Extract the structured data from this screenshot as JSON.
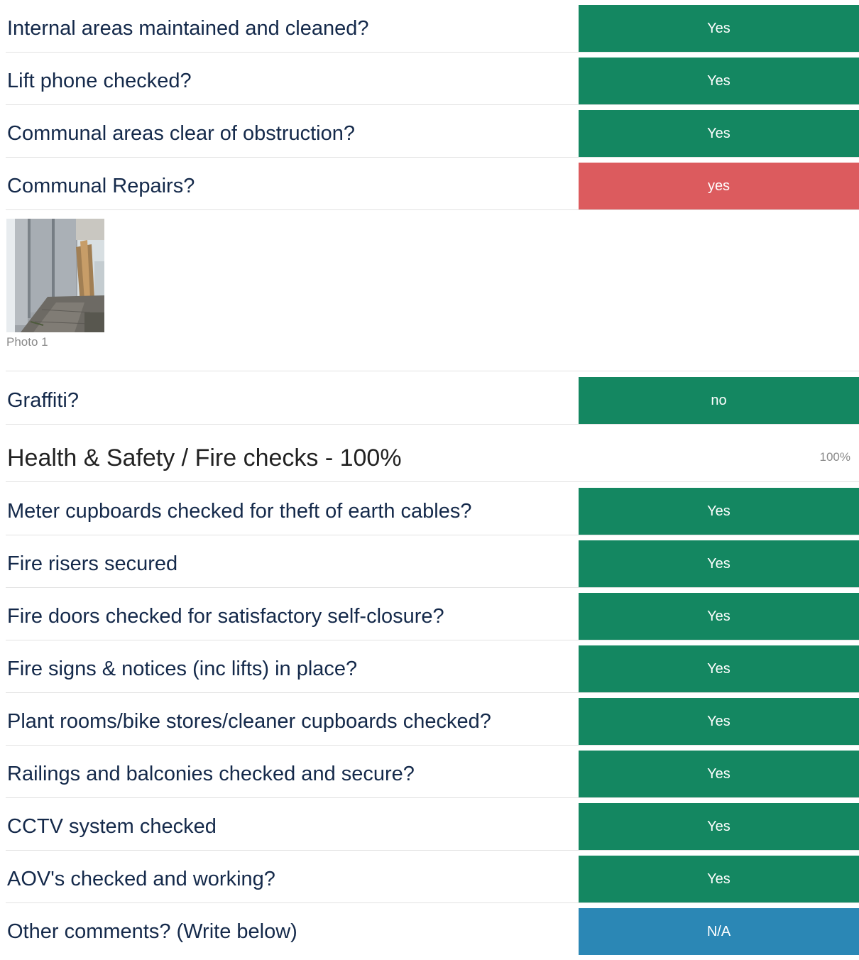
{
  "colors": {
    "green": "#148761",
    "red": "#dc5b5e",
    "blue": "#2b87b5"
  },
  "rows_before_photo": [
    {
      "question": "Internal areas maintained and cleaned?",
      "answer": "Yes",
      "status": "green"
    },
    {
      "question": "Lift phone checked?",
      "answer": "Yes",
      "status": "green"
    },
    {
      "question": "Communal areas clear of obstruction?",
      "answer": "Yes",
      "status": "green"
    },
    {
      "question": "Communal Repairs?",
      "answer": "yes",
      "status": "red"
    }
  ],
  "photo": {
    "caption": "Photo 1"
  },
  "rows_after_photo": [
    {
      "question": "Graffiti?",
      "answer": "no",
      "status": "green"
    }
  ],
  "section": {
    "title": "Health & Safety / Fire checks - 100%",
    "score": "100%"
  },
  "section_rows": [
    {
      "question": "Meter cupboards checked for theft of earth cables?",
      "answer": "Yes",
      "status": "green"
    },
    {
      "question": "Fire risers secured",
      "answer": "Yes",
      "status": "green"
    },
    {
      "question": "Fire doors checked for satisfactory self-closure?",
      "answer": "Yes",
      "status": "green"
    },
    {
      "question": "Fire signs & notices (inc lifts) in place?",
      "answer": "Yes",
      "status": "green"
    },
    {
      "question": "Plant rooms/bike stores/cleaner cupboards checked?",
      "answer": "Yes",
      "status": "green"
    },
    {
      "question": "Railings and balconies checked and secure?",
      "answer": "Yes",
      "status": "green"
    },
    {
      "question": "CCTV system checked",
      "answer": "Yes",
      "status": "green"
    },
    {
      "question": "AOV's checked and working?",
      "answer": "Yes",
      "status": "green"
    },
    {
      "question": "Other comments? (Write below)",
      "answer": "N/A",
      "status": "blue"
    }
  ]
}
